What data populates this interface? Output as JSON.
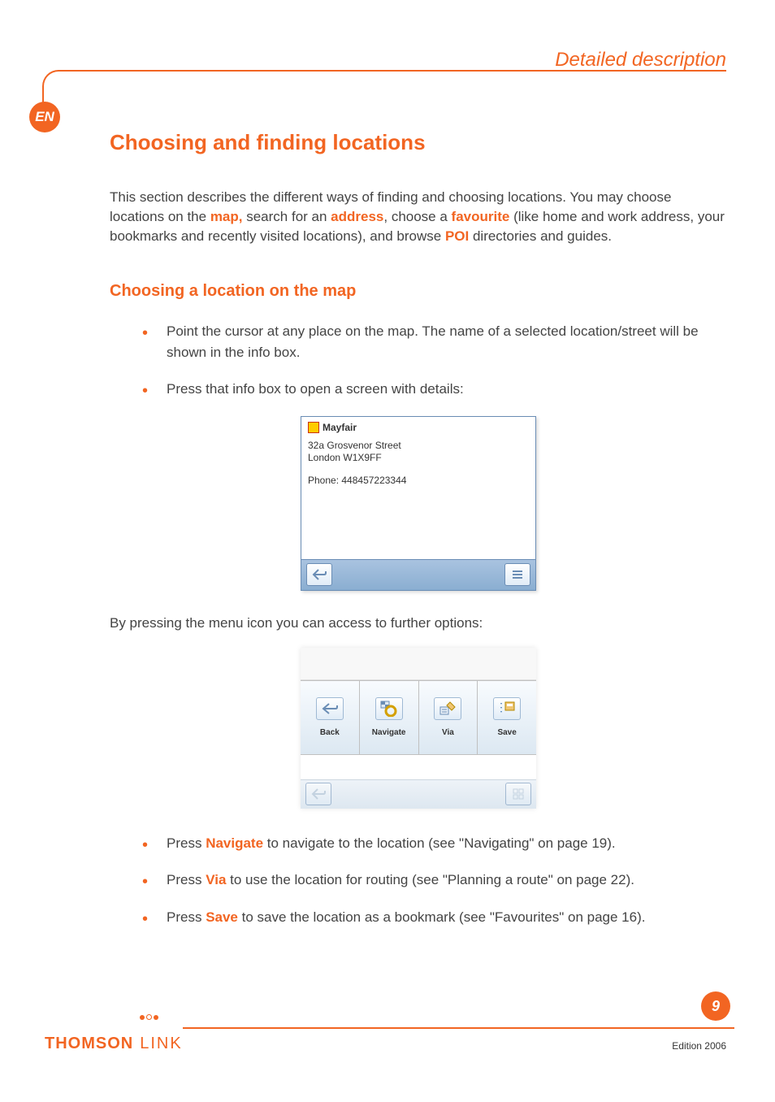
{
  "header": {
    "label": "Detailed description"
  },
  "lang": "EN",
  "title": "Choosing and finding locations",
  "intro": {
    "pre": "This section describes the different ways of finding and choosing locations. You may choose locations on the ",
    "b1": "map,",
    "m1": " search for an ",
    "b2": "address",
    "m2": ", choose a ",
    "b3": "favourite",
    "m3": " (like home and work address, your bookmarks and recently visited locations), and browse ",
    "b4": "POI",
    "m4": " directories and guides."
  },
  "sub1": "Choosing a location on the map",
  "bullets1": [
    "Point the cursor at any place on the map. The name of a selected location/street will be shown in the info box.",
    "Press that info box to open a screen with details:"
  ],
  "shot1": {
    "title": "Mayfair",
    "addr_line1": "32a Grosvenor Street",
    "addr_line2": "London W1X9FF",
    "phone": "Phone: 448457223344"
  },
  "caption2": "By pressing the menu icon you can access to further options:",
  "shot2": {
    "buttons": [
      {
        "label": "Back"
      },
      {
        "label": "Navigate"
      },
      {
        "label": "Via"
      },
      {
        "label": "Save"
      }
    ]
  },
  "bullets2": [
    {
      "pre": "Press ",
      "b": "Navigate",
      "post": " to navigate to the location (see \"Navigating\" on page 19)."
    },
    {
      "pre": "Press ",
      "b": "Via",
      "post": " to use the location for routing (see \"Planning a route\" on page 22)."
    },
    {
      "pre": "Press ",
      "b": "Save",
      "post": " to save the location as a bookmark (see \"Favourites\" on page 16)."
    }
  ],
  "footer": {
    "page": "9",
    "brand1": "THOMSON",
    "brand2": "LINK",
    "edition": "Edition 2006"
  }
}
